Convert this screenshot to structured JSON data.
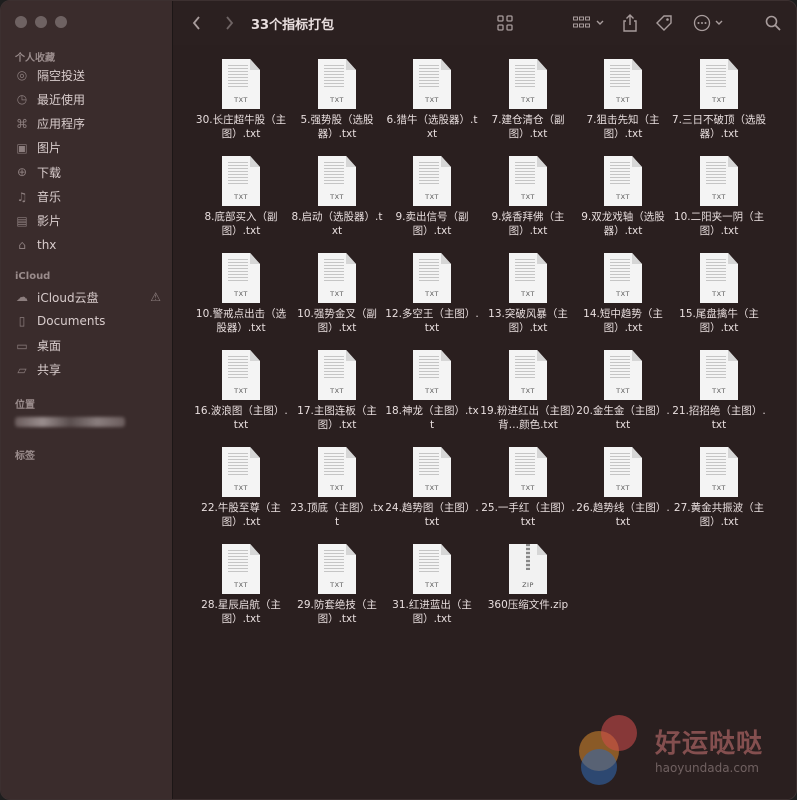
{
  "window": {
    "title": "33个指标打包"
  },
  "sidebar": {
    "favorites_title": "个人收藏",
    "favorites": [
      {
        "label": "隔空投送",
        "icon": "airdrop-icon"
      },
      {
        "label": "最近使用",
        "icon": "clock-icon"
      },
      {
        "label": "应用程序",
        "icon": "applications-icon"
      },
      {
        "label": "图片",
        "icon": "photos-icon"
      },
      {
        "label": "下载",
        "icon": "download-icon"
      },
      {
        "label": "音乐",
        "icon": "music-icon"
      },
      {
        "label": "影片",
        "icon": "movie-icon"
      },
      {
        "label": "thx",
        "icon": "home-icon"
      }
    ],
    "icloud_title": "iCloud",
    "icloud": [
      {
        "label": "iCloud云盘",
        "icon": "cloud-icon"
      },
      {
        "label": "Documents",
        "icon": "document-icon"
      },
      {
        "label": "桌面",
        "icon": "desktop-icon"
      },
      {
        "label": "共享",
        "icon": "shared-folder-icon"
      }
    ],
    "locations_title": "位置",
    "tags_title": "标签"
  },
  "files": [
    {
      "name": "30.长庄超牛股（主图）.txt",
      "ext": "TXT"
    },
    {
      "name": "5.强势股（选股器）.txt",
      "ext": "TXT"
    },
    {
      "name": "6.猎牛（选股器）.txt",
      "ext": "TXT"
    },
    {
      "name": "7.建仓清仓（副图）.txt",
      "ext": "TXT"
    },
    {
      "name": "7.狙击先知（主图）.txt",
      "ext": "TXT"
    },
    {
      "name": "7.三日不破顶（选股器）.txt",
      "ext": "TXT"
    },
    {
      "name": "8.底部买入（副图）.txt",
      "ext": "TXT"
    },
    {
      "name": "8.启动（选股器）.txt",
      "ext": "TXT"
    },
    {
      "name": "9.卖出信号（副图）.txt",
      "ext": "TXT"
    },
    {
      "name": "9.烧香拜佛（主图）.txt",
      "ext": "TXT"
    },
    {
      "name": "9.双龙戏轴（选股器）.txt",
      "ext": "TXT"
    },
    {
      "name": "10.二阳夹一阴（主图）.txt",
      "ext": "TXT"
    },
    {
      "name": "10.警戒点出击（选股器）.txt",
      "ext": "TXT"
    },
    {
      "name": "10.强势金叉（副图）.txt",
      "ext": "TXT"
    },
    {
      "name": "12.多空王（主图）.txt",
      "ext": "TXT"
    },
    {
      "name": "13.突破风暴（主图）.txt",
      "ext": "TXT"
    },
    {
      "name": "14.短中趋势（主图）.txt",
      "ext": "TXT"
    },
    {
      "name": "15.尾盘擒牛（主图）.txt",
      "ext": "TXT"
    },
    {
      "name": "16.波浪图（主图）.txt",
      "ext": "TXT"
    },
    {
      "name": "17.主图连板（主图）.txt",
      "ext": "TXT"
    },
    {
      "name": "18.神龙（主图）.txt",
      "ext": "TXT"
    },
    {
      "name": "19.粉进红出（主图）背…颜色.txt",
      "ext": "TXT"
    },
    {
      "name": "20.金生金（主图）.txt",
      "ext": "TXT"
    },
    {
      "name": "21.招招绝（主图）.txt",
      "ext": "TXT"
    },
    {
      "name": "22.牛股至尊（主图）.txt",
      "ext": "TXT"
    },
    {
      "name": "23.顶底（主图）.txt",
      "ext": "TXT"
    },
    {
      "name": "24.趋势图（主图）.txt",
      "ext": "TXT"
    },
    {
      "name": "25.一手红（主图）.txt",
      "ext": "TXT"
    },
    {
      "name": "26.趋势线（主图）.txt",
      "ext": "TXT"
    },
    {
      "name": "27.黄金共振波（主图）.txt",
      "ext": "TXT"
    },
    {
      "name": "28.星辰启航（主图）.txt",
      "ext": "TXT"
    },
    {
      "name": "29.防套绝技（主图）.txt",
      "ext": "TXT"
    },
    {
      "name": "31.红进蓝出（主图）.txt",
      "ext": "TXT"
    },
    {
      "name": "360压缩文件.zip",
      "ext": "ZIP"
    }
  ],
  "watermark": {
    "brand": "好运哒哒",
    "url": "haoyundada.com"
  }
}
